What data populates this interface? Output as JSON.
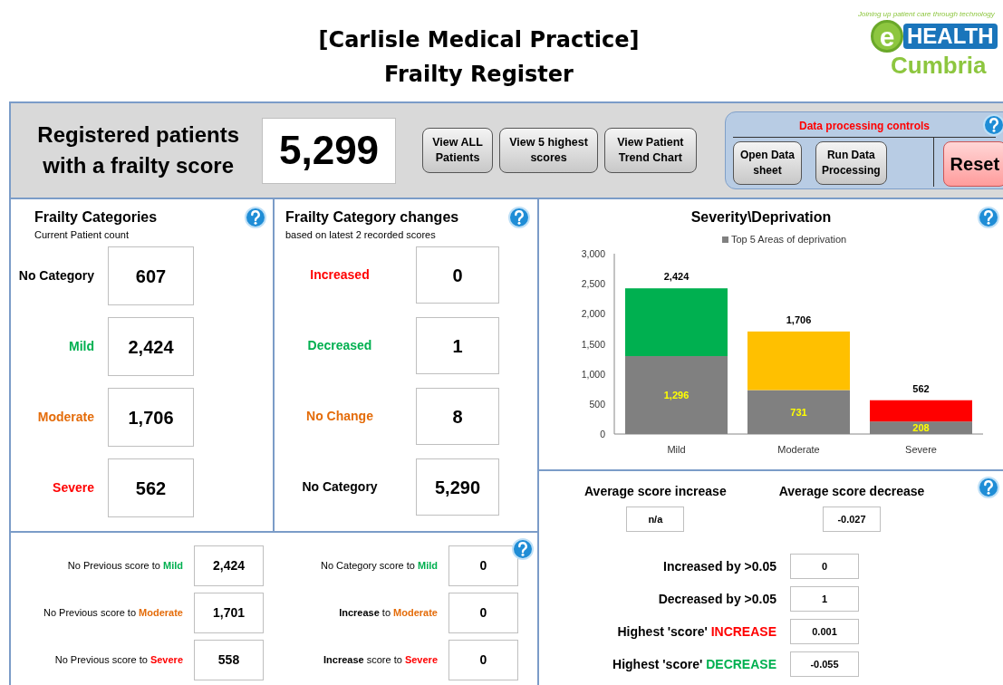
{
  "header": {
    "title_line_1": "[Carlisle Medical Practice]",
    "title_line_2": "Frailty Register",
    "logo": {
      "tagline": "Joining up patient care through technology",
      "letter": "e",
      "word": "HEALTH",
      "region": "Cumbria"
    }
  },
  "summary": {
    "label": "Registered patients with a frailty score",
    "value": "5,299",
    "buttons": [
      "View ALL Patients",
      "View 5 highest scores",
      "View Patient Trend Chart"
    ]
  },
  "controls": {
    "title": "Data processing controls",
    "buttons": [
      "Open Data sheet",
      "Run Data Processing"
    ],
    "reset": "Reset"
  },
  "categories": {
    "title": "Frailty Categories",
    "subtitle": "Current Patient count",
    "rows": [
      {
        "label": "No Category",
        "color": "#000000",
        "value": "607"
      },
      {
        "label": "Mild",
        "color": "#00b050",
        "value": "2,424"
      },
      {
        "label": "Moderate",
        "color": "#e46c0a",
        "value": "1,706"
      },
      {
        "label": "Severe",
        "color": "#ff0000",
        "value": "562"
      }
    ]
  },
  "changes": {
    "title": "Frailty Category changes",
    "subtitle": "based on latest 2 recorded scores",
    "rows": [
      {
        "label": "Increased",
        "color": "#ff0000",
        "value": "0"
      },
      {
        "label": "Decreased",
        "color": "#00b050",
        "value": "1"
      },
      {
        "label": "No Change",
        "color": "#e46c0a",
        "value": "8"
      },
      {
        "label": "No Category",
        "color": "#000000",
        "value": "5,290"
      }
    ]
  },
  "transitions": [
    {
      "label": "No Previous score to",
      "category": "Mild",
      "color": "#00b050",
      "value": "2,424"
    },
    {
      "label": "No Category score to",
      "category": "Mild",
      "color": "#00b050",
      "value": "0"
    },
    {
      "label": "No Previous score to",
      "category": "Moderate",
      "color": "#e46c0a",
      "value": "1,701"
    },
    {
      "label": "**Increase** to",
      "category": "Moderate",
      "color": "#e46c0a",
      "value": "0"
    },
    {
      "label": "No Previous score to",
      "category": "Severe",
      "color": "#ff0000",
      "value": "558"
    },
    {
      "label": "**Increase** score to",
      "category": "Severe",
      "color": "#ff0000",
      "value": "0"
    }
  ],
  "chart": {
    "chart_data": {
      "type": "bar",
      "title": "Severity\\Deprivation",
      "categories": [
        "Mild",
        "Moderate",
        "Severe"
      ],
      "stacked": true,
      "ylim": [
        0,
        3000
      ],
      "yticks": [
        {
          "value": 0,
          "label": "0"
        },
        {
          "value": 500,
          "label": "500"
        },
        {
          "value": 1000,
          "label": "1,000"
        },
        {
          "value": 1500,
          "label": "1,500"
        },
        {
          "value": 2000,
          "label": "2,000"
        },
        {
          "value": 2500,
          "label": "2,500"
        },
        {
          "value": 3000,
          "label": "3,000"
        }
      ],
      "series": [
        {
          "name": "Top 5 Areas of deprivation",
          "color": "#808080",
          "values": [
            1296,
            731,
            208
          ],
          "value_labels": [
            "1,296",
            "731",
            "208"
          ]
        },
        {
          "colors": [
            "#00b050",
            "#ffc000",
            "#ff0000"
          ],
          "values": [
            1128,
            975,
            354
          ]
        }
      ],
      "annotations": [
        "2,424",
        "1,706",
        "562"
      ]
    }
  },
  "averages": [
    {
      "label": "Average score increase",
      "value": "n/a"
    },
    {
      "label": "Average score decrease",
      "value": "-0.027"
    }
  ],
  "thresholds": [
    {
      "label": "Increased by >0.05",
      "value": "0"
    },
    {
      "label": "Decreased by >0.05",
      "value": "1"
    },
    {
      "label": "Highest 'score'",
      "emphasis": "INCREASE",
      "color": "#ff0000",
      "value": "0.001"
    },
    {
      "label": "Highest 'score'",
      "emphasis": "DECREASE",
      "color": "#00b050",
      "value": "-0.055"
    }
  ]
}
